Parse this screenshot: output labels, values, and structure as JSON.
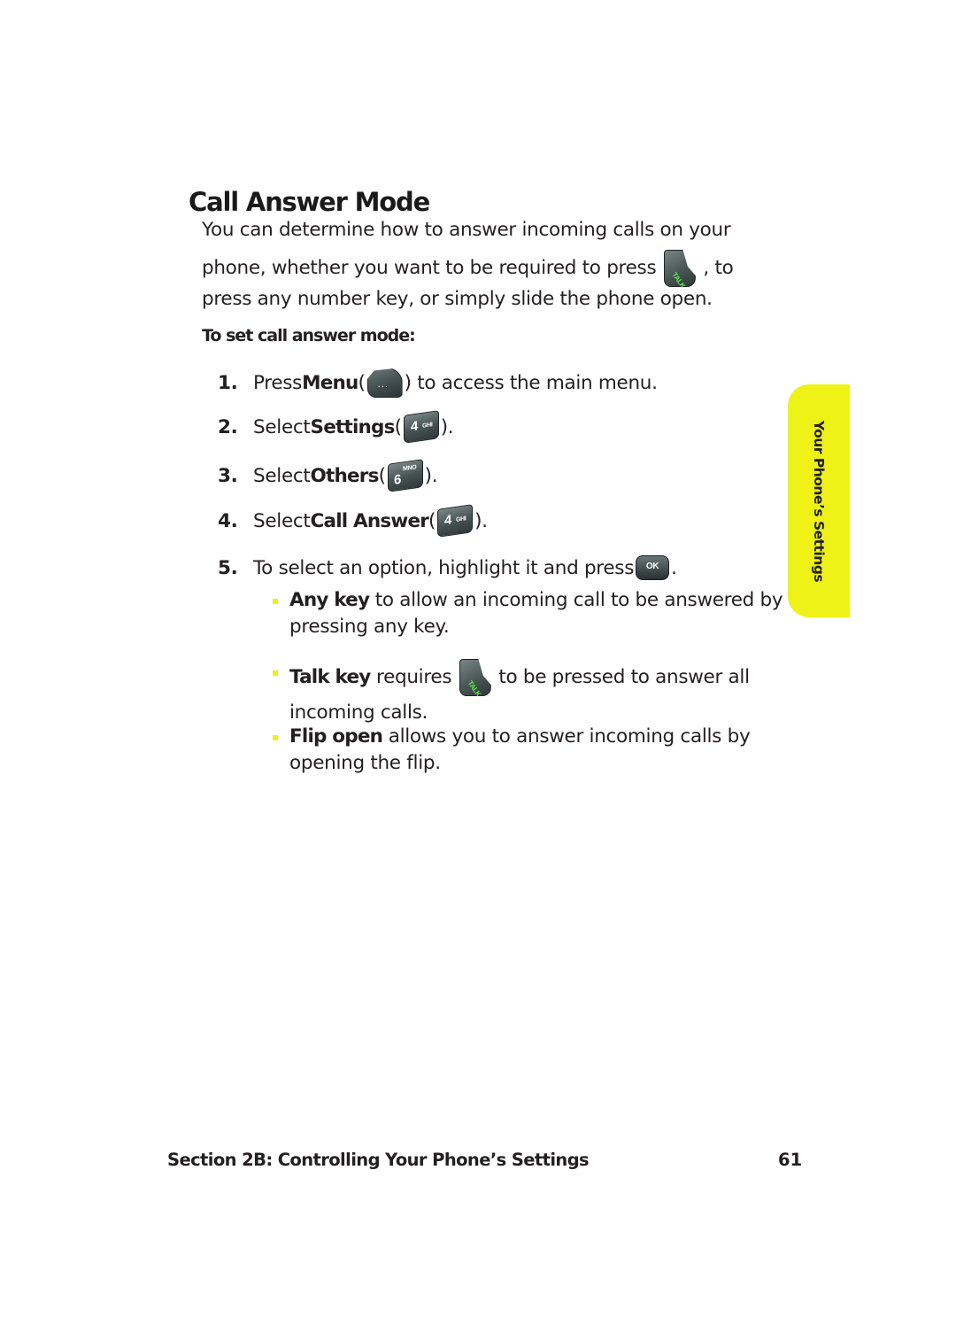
{
  "page": {
    "title": "Call Answer Mode",
    "intro": {
      "line1": "You can determine how to answer incoming calls on your",
      "line2_before": "phone, whether you want to be required to press ",
      "line2_after": " , to",
      "line3": "press any number key, or simply slide the phone open."
    },
    "subheading": "To set call answer mode:",
    "steps": [
      {
        "number": "1.",
        "before": "Press ",
        "bold": "Menu",
        "mid": " (",
        "after": ") to access the main menu.",
        "key": {
          "icon": "menu-key-icon",
          "label": "..."
        }
      },
      {
        "number": "2.",
        "before": "Select ",
        "bold": "Settings",
        "mid": " (",
        "after": ").",
        "key": {
          "icon": "key-4-icon",
          "digit": "4",
          "letters": "GHI"
        }
      },
      {
        "number": "3.",
        "before": "Select ",
        "bold": "Others",
        "mid": " (",
        "after": ").",
        "key": {
          "icon": "key-6-icon",
          "digit": "6",
          "letters": "MNO"
        }
      },
      {
        "number": "4.",
        "before": "Select ",
        "bold": "Call Answer",
        "mid": " (",
        "after": ").",
        "key": {
          "icon": "key-4-icon",
          "digit": "4",
          "letters": "GHI"
        }
      },
      {
        "number": "5.",
        "before": "To select an option, highlight it and press ",
        "after": ".",
        "key": {
          "icon": "ok-key-icon",
          "label": "OK"
        }
      }
    ],
    "options": [
      {
        "bold": "Any key",
        "text": " to allow an incoming call to be answered by pressing any key."
      },
      {
        "bold": "Talk key",
        "text_before": " requires ",
        "text_after": " to be pressed to answer all incoming calls.",
        "key": {
          "icon": "talk-key-icon",
          "label": "TALK"
        }
      },
      {
        "bold": "Flip open",
        "text": " allows you to answer incoming calls by opening the flip."
      }
    ],
    "talk_key_label": "TALK"
  },
  "side_tab": {
    "label": "Your Phone’s Settings",
    "color": "#eef217"
  },
  "footer": {
    "section": "Section 2B: Controlling Your Phone’s Settings",
    "page_number": "61"
  },
  "colors": {
    "bullet": "#f2ef13",
    "talk_text": "#5cf04a",
    "text": "#231f20"
  }
}
